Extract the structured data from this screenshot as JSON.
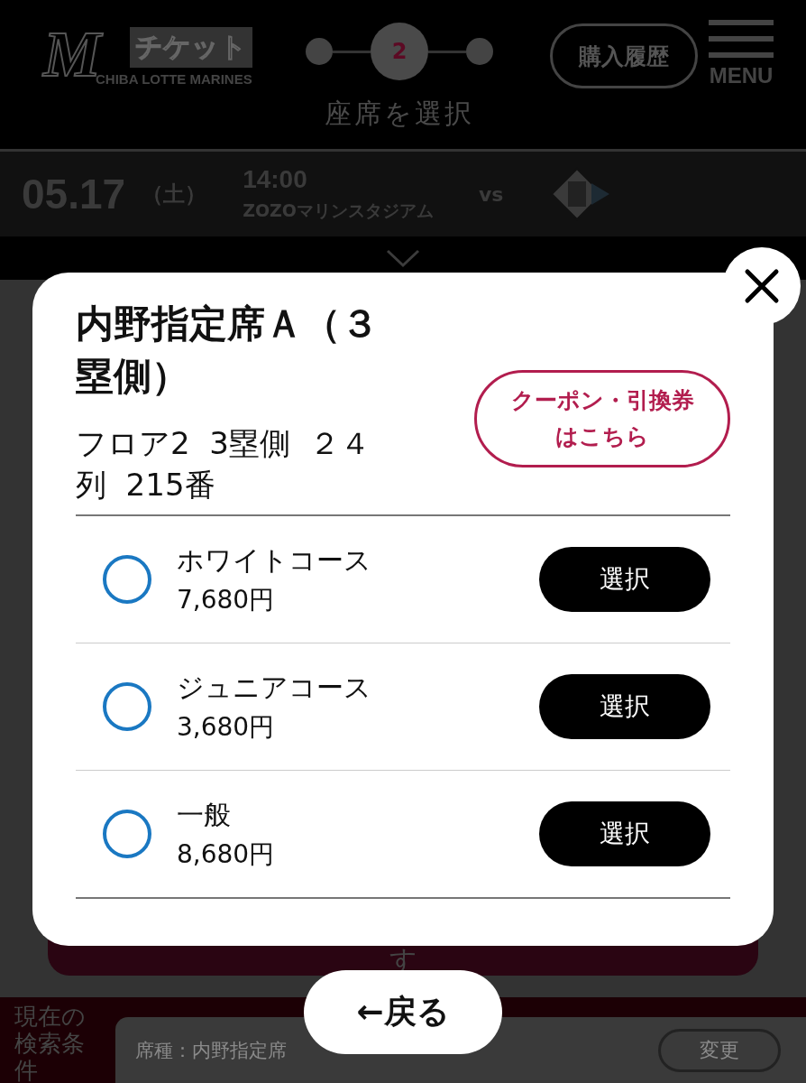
{
  "header": {
    "logo_mark": "M",
    "logo_title": "チケット",
    "logo_subtitle": "CHIBA LOTTE MARINES",
    "steps": [
      {
        "selected": false
      },
      {
        "number": "2",
        "selected": true
      },
      {
        "selected": false
      }
    ],
    "step_label": "座席を選択",
    "history_button": "購入履歴",
    "menu_label": "MENU"
  },
  "game": {
    "date": "05.17",
    "weekday": "（土）",
    "time": "14:00",
    "venue": "ZOZOマリンスタジアム",
    "vs": "vs"
  },
  "behind_button": "す",
  "modal": {
    "title": "内野指定席Ａ（３塁側）",
    "seat": "フロア2  3塁側  ２４列  215番",
    "coupon_button": "クーポン・引換券はこちら",
    "courses": [
      {
        "name": "ホワイトコース",
        "price": "7,680円",
        "selected": false,
        "button": "選択"
      },
      {
        "name": "ジュニアコース",
        "price": "3,680円",
        "selected": false,
        "button": "選択"
      },
      {
        "name": "一般",
        "price": "8,680円",
        "selected": false,
        "button": "選択"
      }
    ]
  },
  "back_button": "←戻る",
  "search_bar": {
    "label": "現在の検索条件",
    "value": "席種：内野指定席",
    "change_button": "変更"
  }
}
